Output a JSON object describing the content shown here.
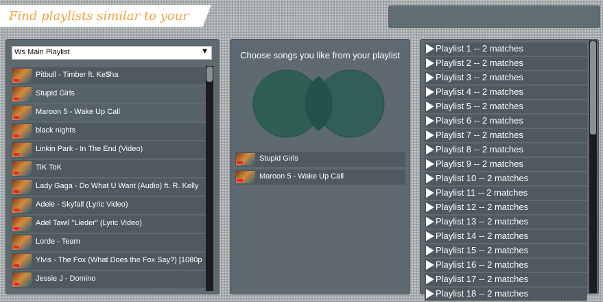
{
  "header": {
    "title": "Find playlists similar to your"
  },
  "playlist_select": {
    "selected": "Ws Main Playlist"
  },
  "songs": [
    {
      "title": "Pitbull - Timber ft. Ke$ha"
    },
    {
      "title": "Stupid Girls"
    },
    {
      "title": "Maroon 5 - Wake Up Call"
    },
    {
      "title": "black nights"
    },
    {
      "title": "Linkin Park - In The End (Video)"
    },
    {
      "title": "TiK ToK"
    },
    {
      "title": "Lady Gaga - Do What U Want (Audio) ft. R. Kelly"
    },
    {
      "title": "Adele - Skyfall (Lyric Video)"
    },
    {
      "title": "Adel Tawil \"Lieder\" (Lyric Video)"
    },
    {
      "title": "Lorde - Team"
    },
    {
      "title": "Ylvis - The Fox (What Does the Fox Say?) [1080p"
    },
    {
      "title": "Jessie J - Domino"
    }
  ],
  "middle": {
    "instruction": "Choose songs you like from your playlist",
    "selected_songs": [
      {
        "title": "Stupid Girls"
      },
      {
        "title": "Maroon 5 - Wake Up Call"
      }
    ]
  },
  "results": [
    {
      "label": "Playlist 1 -- 2 matches"
    },
    {
      "label": "Playlist 2 -- 2 matches"
    },
    {
      "label": "Playlist 3 -- 2 matches"
    },
    {
      "label": "Playlist 4 -- 2 matches"
    },
    {
      "label": "Playlist 5 -- 2 matches"
    },
    {
      "label": "Playlist 6 -- 2 matches"
    },
    {
      "label": "Playlist 7 -- 2 matches"
    },
    {
      "label": "Playlist 8 -- 2 matches"
    },
    {
      "label": "Playlist 9 -- 2 matches"
    },
    {
      "label": "Playlist 10 -- 2 matches"
    },
    {
      "label": "Playlist 11 -- 2 matches"
    },
    {
      "label": "Playlist 12 -- 2 matches"
    },
    {
      "label": "Playlist 13 -- 2 matches"
    },
    {
      "label": "Playlist 14 -- 2 matches"
    },
    {
      "label": "Playlist 15 -- 2 matches"
    },
    {
      "label": "Playlist 16 -- 2 matches"
    },
    {
      "label": "Playlist 17 -- 2 matches"
    },
    {
      "label": "Playlist 18 -- 2 matches"
    }
  ],
  "colors": {
    "title_accent": "#f2a33a",
    "panel": "#5e6a6f",
    "row": "#4e5a5f",
    "venn_fill": "#2e5e54"
  }
}
